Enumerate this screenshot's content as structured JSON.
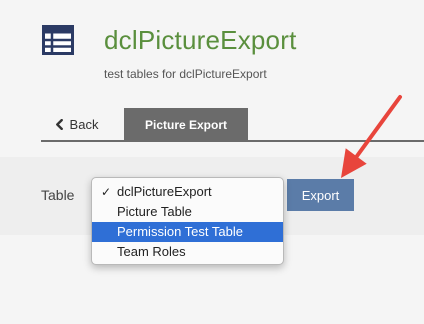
{
  "header": {
    "title": "dclPictureExport",
    "subtitle": "test tables for dclPictureExport",
    "icon": "table-icon"
  },
  "tabs": {
    "back_label": "Back",
    "back_icon": "chevron-left-icon",
    "active_label": "Picture Export"
  },
  "form": {
    "table_label": "Table",
    "export_label": "Export"
  },
  "dropdown": {
    "checkmark": "✓",
    "items": [
      {
        "label": "dclPictureExport",
        "checked": true,
        "highlighted": false
      },
      {
        "label": "Picture Table",
        "checked": false,
        "highlighted": false
      },
      {
        "label": "Permission Test Table",
        "checked": false,
        "highlighted": true
      },
      {
        "label": "Team Roles",
        "checked": false,
        "highlighted": false
      }
    ]
  },
  "annotation": {
    "color": "#e8453c",
    "shape": "arrow"
  },
  "colors": {
    "title_green": "#5a8f3d",
    "icon_navy": "#2b3a64",
    "tab_gray": "#6b6b6b",
    "export_blue": "#5b7ca8",
    "selection_blue": "#2f6fd6"
  }
}
